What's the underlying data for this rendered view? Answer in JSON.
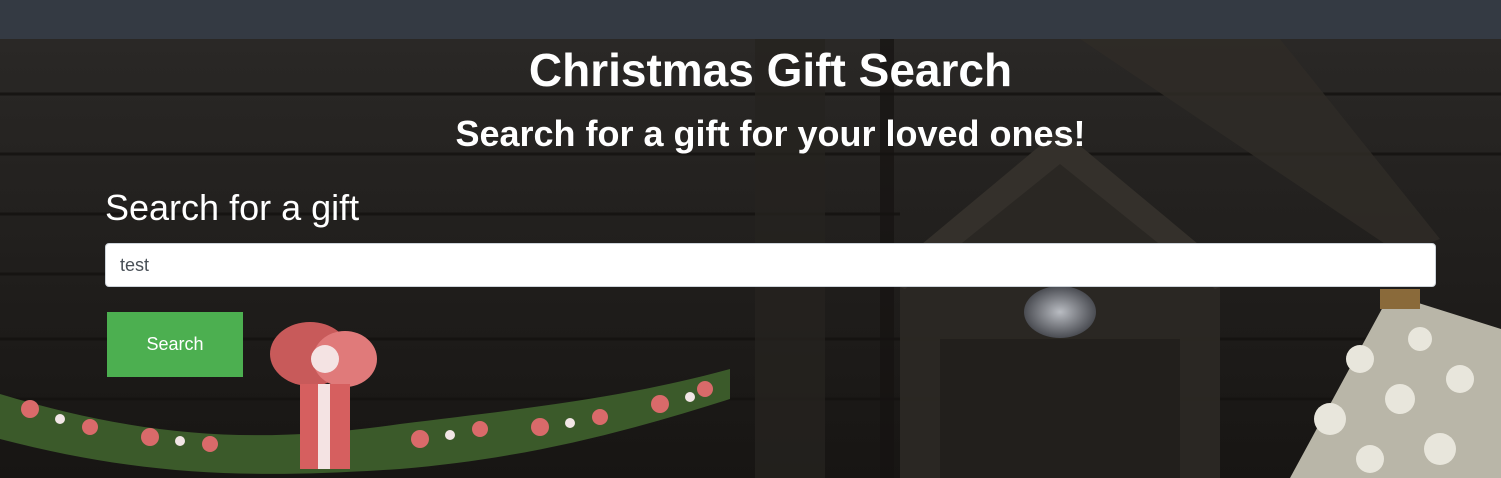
{
  "header": {
    "title": "Christmas Gift Search",
    "subtitle": "Search for a gift for your loved ones!"
  },
  "search": {
    "label": "Search for a gift",
    "value": "test",
    "button_label": "Search"
  },
  "colors": {
    "navbar": "#343a43",
    "button": "#4caf50"
  }
}
